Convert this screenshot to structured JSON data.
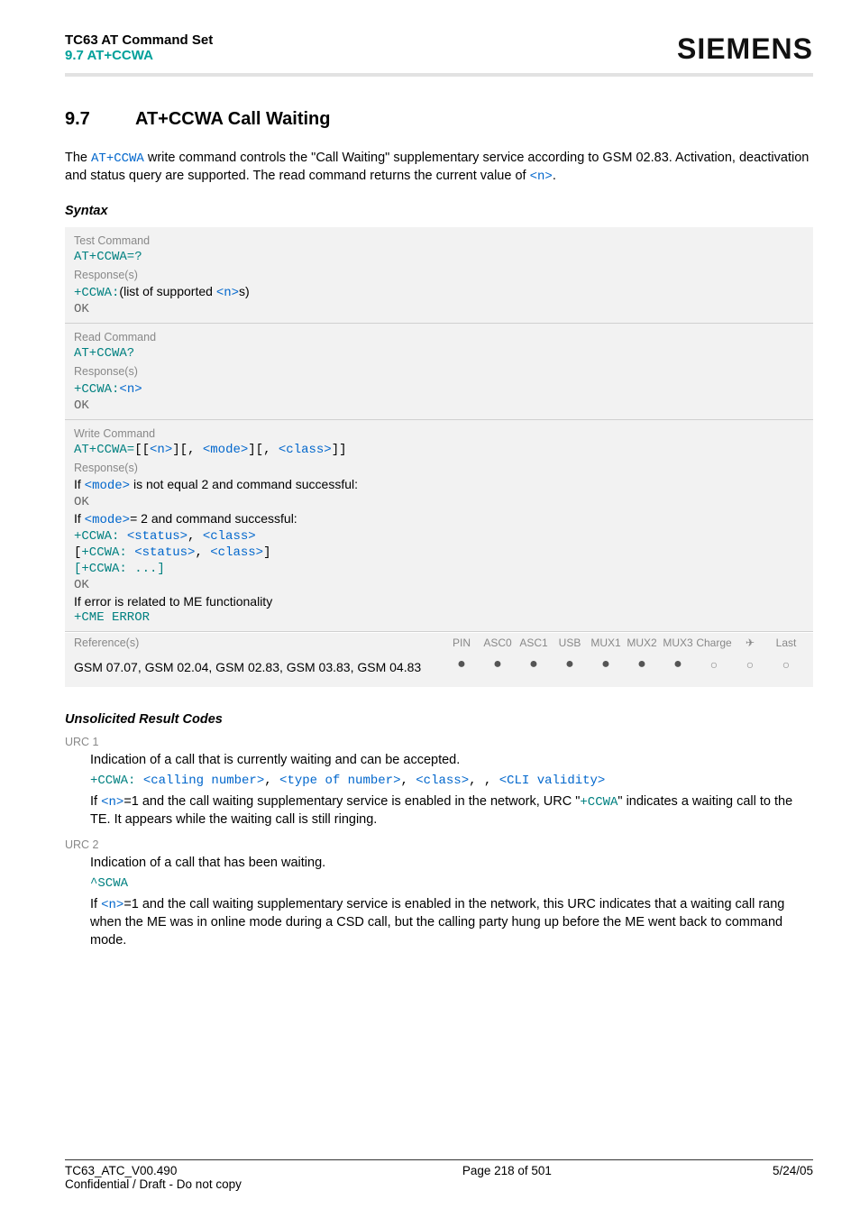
{
  "header": {
    "line1": "TC63 AT Command Set",
    "line2": "9.7 AT+CCWA",
    "logo": "SIEMENS"
  },
  "section": {
    "num": "9.7",
    "title": "AT+CCWA   Call Waiting"
  },
  "intro": {
    "pre": "The ",
    "link": "AT+CCWA",
    "mid": " write command controls the \"Call Waiting\" supplementary service according to GSM 02.83. Activation, deactivation and status query are supported. The read command returns the current value of ",
    "end": ".",
    "n_link": "<n>"
  },
  "syntax": {
    "heading": "Syntax",
    "test": {
      "label": "Test Command",
      "cmd": "AT+CCWA=?",
      "resp_label": "Response(s)",
      "resp_pre": "+CCWA:",
      "resp_mid": "(list of supported ",
      "resp_n": "<n>",
      "resp_post": "s)",
      "ok": "OK"
    },
    "read": {
      "label": "Read Command",
      "cmd": "AT+CCWA?",
      "resp_label": "Response(s)",
      "resp_pre": "+CCWA:",
      "resp_n": "<n>",
      "ok": "OK"
    },
    "write": {
      "label": "Write Command",
      "cmd_pre": "AT+CCWA=",
      "n": "<n>",
      "mode": "<mode>",
      "class": "<class>",
      "resp_label": "Response(s)",
      "line_if1_a": "If ",
      "line_if1_b": " is not equal 2 and command successful:",
      "ok1": "OK",
      "line_if2_a": "If ",
      "line_if2_b": "= 2 and command successful:",
      "ccwa": "+CCWA: ",
      "status": "<status>",
      "class2": "<class>",
      "ccwa_dots": "[+CCWA: ...]",
      "ok2": "OK",
      "err": "If error is related to ME functionality",
      "cme": "+CME ERROR"
    },
    "refs": {
      "label": "Reference(s)",
      "text": "GSM 07.07, GSM 02.04, GSM 02.83, GSM 03.83, GSM 04.83",
      "cols": [
        "PIN",
        "ASC0",
        "ASC1",
        "USB",
        "MUX1",
        "MUX2",
        "MUX3",
        "Charge",
        "✈",
        "Last"
      ],
      "dots": [
        "f",
        "f",
        "f",
        "f",
        "f",
        "f",
        "f",
        "o",
        "o",
        "o"
      ]
    }
  },
  "urc_heading": "Unsolicited Result Codes",
  "urc1": {
    "label": "URC 1",
    "desc": "Indication of a call that is currently waiting and can be accepted.",
    "code_pre": "+CCWA: ",
    "calling": "<calling number>",
    "type": "<type of number>",
    "class": "<class>",
    "cli": "<CLI validity>",
    "p2a": "If ",
    "p2n": "<n>",
    "p2b": "=1 and the call waiting supplementary service is enabled in the network, URC \"",
    "p2c": "+CCWA",
    "p2d": "\" indicates a waiting call to the TE. It appears while the waiting call is still ringing."
  },
  "urc2": {
    "label": "URC 2",
    "desc": "Indication of a call that has been waiting.",
    "code": "^SCWA",
    "p2a": "If ",
    "p2n": "<n>",
    "p2b": "=1 and the call waiting supplementary service is enabled in the network, this URC indicates that a waiting call rang when the ME was in online mode during a CSD call, but the calling party hung up before the ME went back to command mode."
  },
  "footer": {
    "left1": "TC63_ATC_V00.490",
    "left2": "Confidential / Draft - Do not copy",
    "center": "Page 218 of 501",
    "right": "5/24/05"
  }
}
